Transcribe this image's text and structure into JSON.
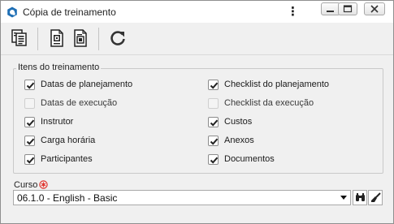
{
  "window": {
    "title": "Cópia de treinamento"
  },
  "toolbar": {
    "buttons": [
      {
        "name": "copy-icon"
      },
      {
        "name": "import-icon"
      },
      {
        "name": "export-icon"
      },
      {
        "name": "refresh-icon"
      }
    ]
  },
  "group": {
    "legend": "Itens do treinamento",
    "items": [
      {
        "label": "Datas de planejamento",
        "checked": true,
        "enabled": true
      },
      {
        "label": "Checklist do planejamento",
        "checked": true,
        "enabled": true
      },
      {
        "label": "Datas de execução",
        "checked": false,
        "enabled": false
      },
      {
        "label": "Checklist da execução",
        "checked": false,
        "enabled": false
      },
      {
        "label": "Instrutor",
        "checked": true,
        "enabled": true
      },
      {
        "label": "Custos",
        "checked": true,
        "enabled": true
      },
      {
        "label": "Carga horária",
        "checked": true,
        "enabled": true
      },
      {
        "label": "Anexos",
        "checked": true,
        "enabled": true
      },
      {
        "label": "Participantes",
        "checked": true,
        "enabled": true
      },
      {
        "label": "Documentos",
        "checked": true,
        "enabled": true
      }
    ]
  },
  "curso": {
    "label": "Curso",
    "value": "06.1.0 - English - Basic"
  },
  "colors": {
    "required": "#e0302a",
    "refresh": "#333333"
  }
}
